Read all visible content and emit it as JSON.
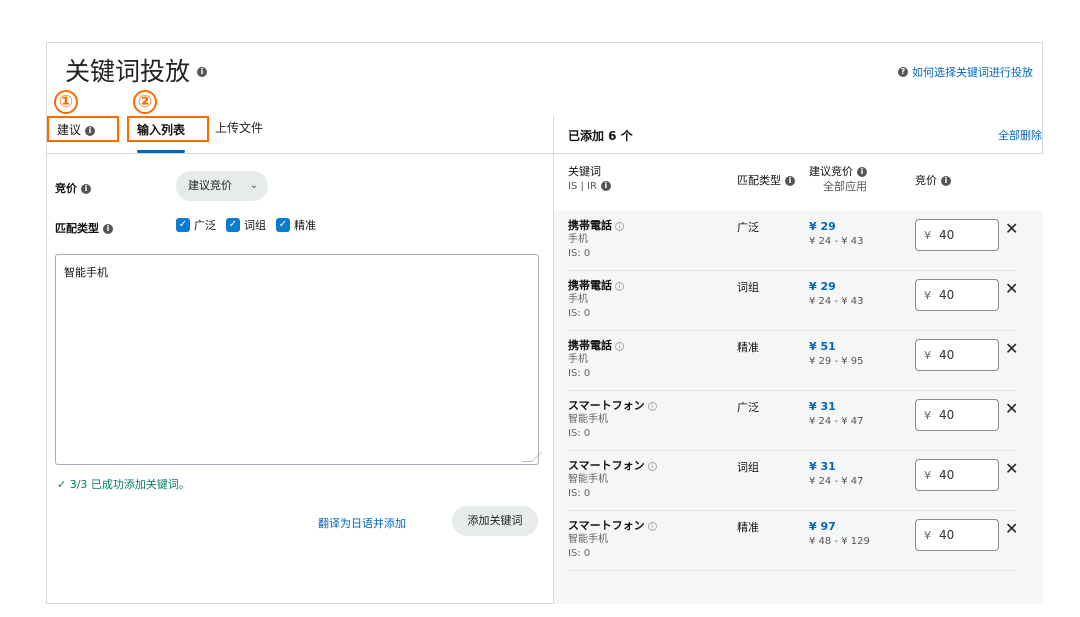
{
  "header": {
    "title": "关键词投放",
    "help_link": "如何选择关键词进行投放"
  },
  "markers": [
    "①",
    "②"
  ],
  "tabs": [
    {
      "label": "建议"
    },
    {
      "label": "输入列表"
    },
    {
      "label": "上传文件"
    }
  ],
  "left": {
    "bid_label": "竞价",
    "bid_select_value": "建议竞价",
    "match_label": "匹配类型",
    "match_options": [
      "广泛",
      "词组",
      "精准"
    ],
    "keyword_text": "智能手机",
    "success_message": "3/3 已成功添加关键词。",
    "translate_link": "翻译为日语并添加",
    "add_button": "添加关键词"
  },
  "right": {
    "added_count": "已添加 6 个",
    "delete_all": "全部删除",
    "columns": {
      "keyword": "关键词",
      "keyword_sub": "IS | IR",
      "match": "匹配类型",
      "suggested": "建议竞价",
      "suggested_sub": "全部应用",
      "bid": "竞价"
    },
    "rows": [
      {
        "keyword": "携帯電話",
        "translation": "手机",
        "is": "IS: 0",
        "match": "广泛",
        "suggested": "¥ 29",
        "range": "¥ 24 - ¥ 43",
        "currency": "¥",
        "bid": "40"
      },
      {
        "keyword": "携帯電話",
        "translation": "手机",
        "is": "IS: 0",
        "match": "词组",
        "suggested": "¥ 29",
        "range": "¥ 24 - ¥ 43",
        "currency": "¥",
        "bid": "40"
      },
      {
        "keyword": "携帯電話",
        "translation": "手机",
        "is": "IS: 0",
        "match": "精准",
        "suggested": "¥ 51",
        "range": "¥ 29 - ¥ 95",
        "currency": "¥",
        "bid": "40"
      },
      {
        "keyword": "スマートフォン",
        "translation": "智能手机",
        "is": "IS: 0",
        "match": "广泛",
        "suggested": "¥ 31",
        "range": "¥ 24 - ¥ 47",
        "currency": "¥",
        "bid": "40"
      },
      {
        "keyword": "スマートフォン",
        "translation": "智能手机",
        "is": "IS: 0",
        "match": "词组",
        "suggested": "¥ 31",
        "range": "¥ 24 - ¥ 47",
        "currency": "¥",
        "bid": "40"
      },
      {
        "keyword": "スマートフォン",
        "translation": "智能手机",
        "is": "IS: 0",
        "match": "精准",
        "suggested": "¥ 97",
        "range": "¥ 48 - ¥ 129",
        "currency": "¥",
        "bid": "40"
      }
    ]
  },
  "colors": {
    "accent": "#0066c0",
    "marker": "#ff6a00",
    "success": "#067d62",
    "checkbox": "#0a7cd0"
  }
}
